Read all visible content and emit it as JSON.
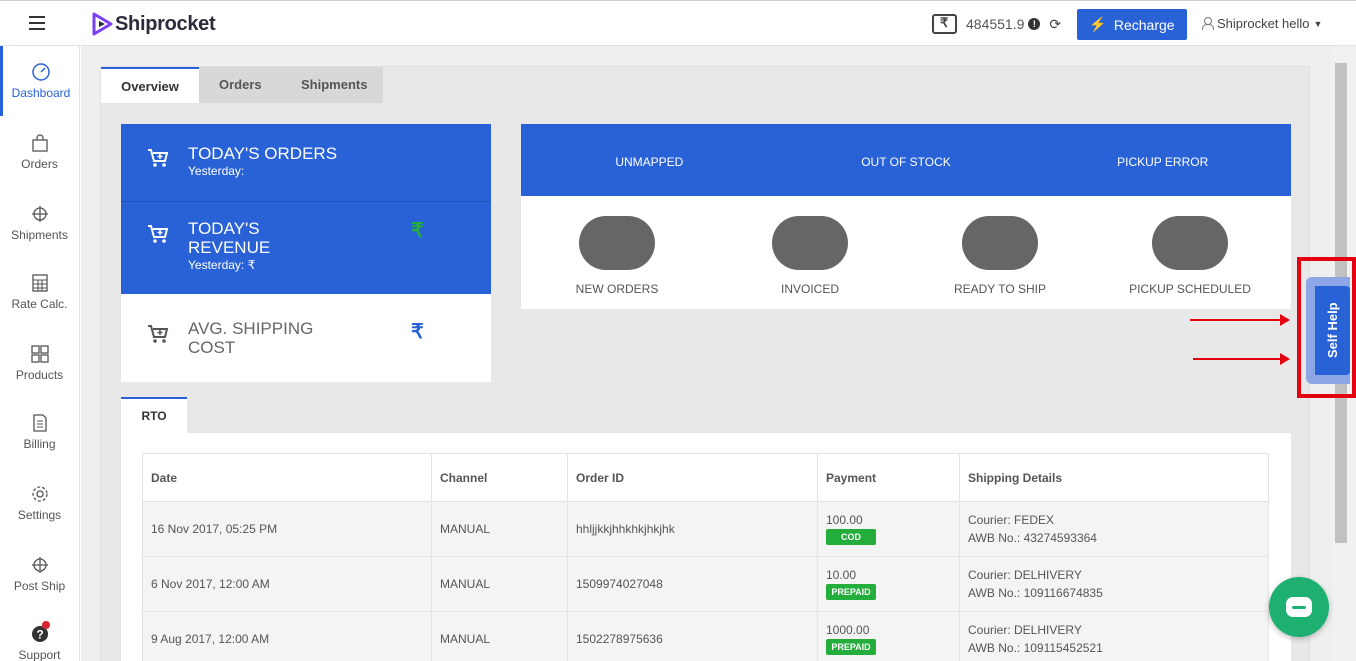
{
  "header": {
    "brand": "Shiprocket",
    "wallet_balance": "484551.9",
    "recharge_label": "Recharge",
    "user_name": "Shiprocket hello"
  },
  "sidebar": {
    "items": [
      {
        "label": "Dashboard",
        "icon": "dashboard-gauge-icon",
        "active": true
      },
      {
        "label": "Orders",
        "icon": "shopping-bag-icon",
        "active": false
      },
      {
        "label": "Shipments",
        "icon": "crosshair-icon",
        "active": false
      },
      {
        "label": "Rate Calc.",
        "icon": "calculator-icon",
        "active": false
      },
      {
        "label": "Products",
        "icon": "grid-icon",
        "active": false
      },
      {
        "label": "Billing",
        "icon": "document-icon",
        "active": false
      },
      {
        "label": "Settings",
        "icon": "gear-icon",
        "active": false
      },
      {
        "label": "Post Ship",
        "icon": "crosshair-icon",
        "active": false
      },
      {
        "label": "Support",
        "icon": "help-icon",
        "active": false
      }
    ]
  },
  "tabs": [
    {
      "label": "Overview",
      "active": true
    },
    {
      "label": "Orders",
      "active": false
    },
    {
      "label": "Shipments",
      "active": false
    }
  ],
  "cards": {
    "todays_orders": {
      "title": "TODAY'S ORDERS",
      "sub": "Yesterday:"
    },
    "todays_revenue": {
      "title_line1": "TODAY'S",
      "title_line2": "REVENUE",
      "sub": "Yesterday: ₹",
      "currency": "₹"
    },
    "avg_shipping": {
      "title_line1": "AVG. SHIPPING",
      "title_line2": "COST",
      "currency": "₹"
    }
  },
  "status": {
    "headers": [
      "UNMAPPED",
      "OUT OF STOCK",
      "PICKUP ERROR"
    ],
    "pills": [
      "NEW ORDERS",
      "INVOICED",
      "READY TO SHIP",
      "PICKUP SCHEDULED"
    ]
  },
  "rto": {
    "tab_label": "RTO",
    "columns": [
      "Date",
      "Channel",
      "Order ID",
      "Payment",
      "Shipping Details"
    ],
    "rows": [
      {
        "date": "16 Nov 2017, 05:25 PM",
        "channel": "MANUAL",
        "order_id": "hhljjkkjhhkhkjhkjhk",
        "amount": "100.00",
        "payment_type": "COD",
        "courier": "Courier: FEDEX",
        "awb": "AWB No.: 43274593364"
      },
      {
        "date": "6 Nov 2017, 12:00 AM",
        "channel": "MANUAL",
        "order_id": "1509974027048",
        "amount": "10.00",
        "payment_type": "PREPAID",
        "courier": "Courier: DELHIVERY",
        "awb": "AWB No.: 109116674835"
      },
      {
        "date": "9 Aug 2017, 12:00 AM",
        "channel": "MANUAL",
        "order_id": "1502278975636",
        "amount": "1000.00",
        "payment_type": "PREPAID",
        "courier": "Courier: DELHIVERY",
        "awb": "AWB No.: 109115452521"
      }
    ]
  },
  "self_help": {
    "label": "Self Help"
  },
  "colors": {
    "primary": "#2962d7",
    "success": "#23ad3a",
    "highlight": "#e3000f",
    "chat": "#1eb071"
  }
}
